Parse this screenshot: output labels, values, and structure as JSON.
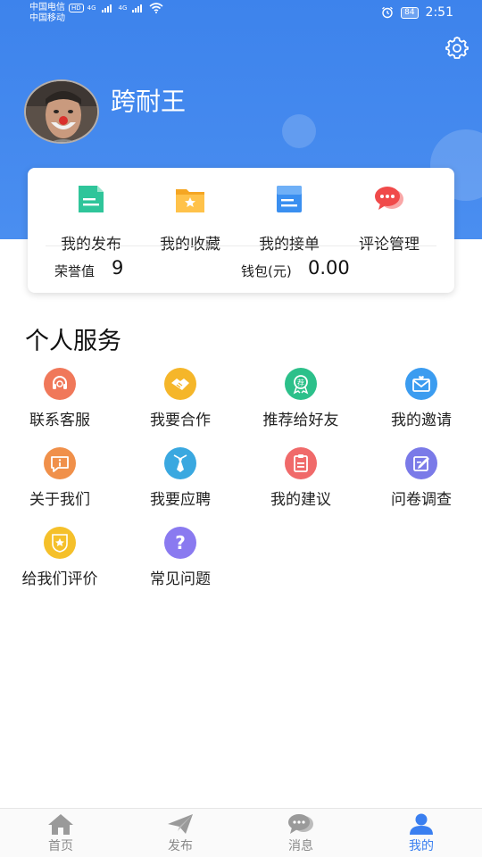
{
  "status_bar": {
    "carrier1": "中国电信",
    "hd": "HD",
    "net1": "4G",
    "carrier2": "中国移动",
    "net2": "4G",
    "battery": "84",
    "time": "2:51"
  },
  "profile": {
    "username": "跨耐王"
  },
  "quick_actions": [
    {
      "label": "我的发布",
      "icon": "document-icon",
      "color": "#2fc59a"
    },
    {
      "label": "我的收藏",
      "icon": "folder-star-icon",
      "color": "#f5a623"
    },
    {
      "label": "我的接单",
      "icon": "order-list-icon",
      "color": "#3a8ff0"
    },
    {
      "label": "评论管理",
      "icon": "chat-bubble-icon",
      "color": "#f04a4a"
    }
  ],
  "stats": {
    "honor_label": "荣誉值",
    "honor_value": "9",
    "wallet_label": "钱包(元)",
    "wallet_value": "0.00"
  },
  "services": {
    "title": "个人服务",
    "items": [
      {
        "label": "联系客服",
        "icon": "headset-icon",
        "color": "#f0785a"
      },
      {
        "label": "我要合作",
        "icon": "handshake-icon",
        "color": "#f5b62a"
      },
      {
        "label": "推荐给好友",
        "icon": "recommend-badge-icon",
        "color": "#2cc08a"
      },
      {
        "label": "我的邀请",
        "icon": "invitation-icon",
        "color": "#3b9cf0"
      },
      {
        "label": "关于我们",
        "icon": "info-icon",
        "color": "#f0904a"
      },
      {
        "label": "我要应聘",
        "icon": "tie-icon",
        "color": "#3aa8e0"
      },
      {
        "label": "我的建议",
        "icon": "clipboard-icon",
        "color": "#f06a6a"
      },
      {
        "label": "问卷调查",
        "icon": "survey-icon",
        "color": "#7a7ae8"
      },
      {
        "label": "给我们评价",
        "icon": "rating-icon",
        "color": "#f5c02a"
      },
      {
        "label": "常见问题",
        "icon": "question-icon",
        "color": "#8a7af0"
      }
    ]
  },
  "tabs": [
    {
      "label": "首页",
      "icon": "home-icon"
    },
    {
      "label": "发布",
      "icon": "paper-plane-icon"
    },
    {
      "label": "消息",
      "icon": "message-icon"
    },
    {
      "label": "我的",
      "icon": "user-icon",
      "active": true
    }
  ],
  "colors": {
    "header_blue": "#3d83ec",
    "active_tab": "#3a7ff0",
    "inactive_tab": "#8a8a8a"
  }
}
